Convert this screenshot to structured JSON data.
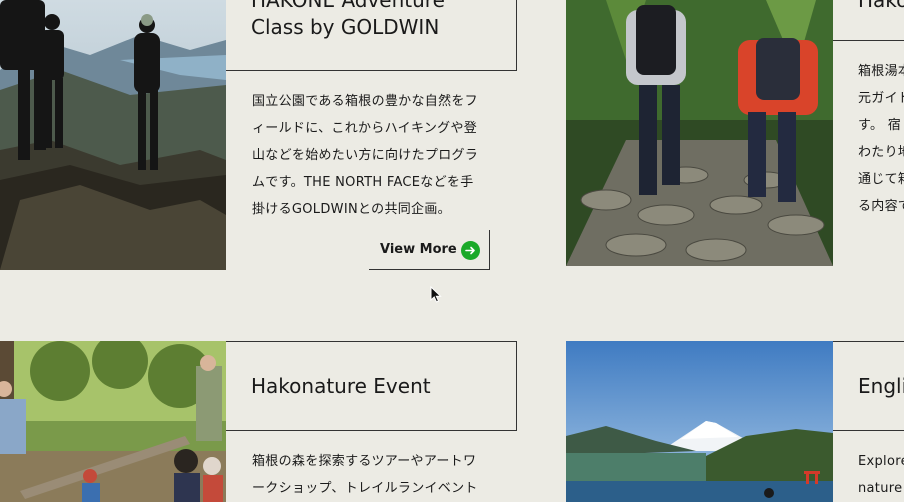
{
  "colors": {
    "background": "#ecebe4",
    "line": "#333333",
    "accent": "#1aa928"
  },
  "cards": [
    {
      "title_line1": "HAKONE Adventure",
      "title_line2": "Class by GOLDWIN",
      "description": [
        "国立公園である箱根の豊かな自然をフ",
        "ィールドに、これからハイキングや登",
        "山などを始めたい方に向けたプログラ",
        "ムです。THE NORTH FACEなどを手",
        "掛けるGOLDWINとの共同企画。"
      ],
      "view_more_label": "View More",
      "view_more_icon": "arrow-right-icon"
    },
    {
      "title": "Hako",
      "description": [
        "箱根湯本",
        "元ガイド",
        "す。 宿",
        "わたり地",
        "通じて箱",
        "る内容で"
      ]
    },
    {
      "title": "Hakonature Event",
      "description": [
        "箱根の森を探索するツアーやアートワ",
        "ークショップ、トレイルランイベント"
      ]
    },
    {
      "title": "Engli",
      "description": [
        "Explore",
        "nature"
      ]
    }
  ],
  "cursor_icon": "mouse-pointer-icon"
}
